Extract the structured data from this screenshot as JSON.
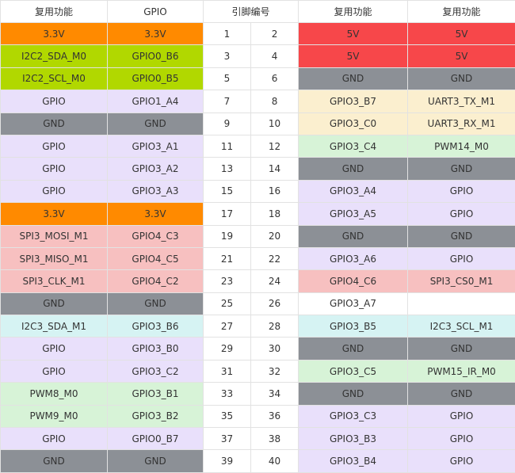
{
  "headers": {
    "left_func": "复用功能",
    "left_gpio": "GPIO",
    "pin_number": "引脚编号",
    "right_gpio_func": "复用功能",
    "right_func": "复用功能"
  },
  "colors": {
    "orange": "#ff8a00",
    "lime": "#b1d800",
    "lavender": "#e9e0fb",
    "gray": "#8c9096",
    "pink": "#f7c0c0",
    "cyan": "#d6f3f3",
    "green": "#d7f3d7",
    "red": "#f7474a",
    "cream": "#fbefcf",
    "white": "#ffffff"
  },
  "rows": [
    {
      "lf": "3.3V",
      "lg": "3.3V",
      "lc": "orange",
      "pl": "1",
      "pr": "2",
      "rg": "5V",
      "rf": "5V",
      "rc": "red"
    },
    {
      "lf": "I2C2_SDA_M0",
      "lg": "GPIO0_B6",
      "lc": "lime",
      "pl": "3",
      "pr": "4",
      "rg": "5V",
      "rf": "5V",
      "rc": "red"
    },
    {
      "lf": "I2C2_SCL_M0",
      "lg": "GPIO0_B5",
      "lc": "lime",
      "pl": "5",
      "pr": "6",
      "rg": "GND",
      "rf": "GND",
      "rc": "gray"
    },
    {
      "lf": "GPIO",
      "lg": "GPIO1_A4",
      "lc": "lav",
      "pl": "7",
      "pr": "8",
      "rg": "GPIO3_B7",
      "rf": "UART3_TX_M1",
      "rc": "cream"
    },
    {
      "lf": "GND",
      "lg": "GND",
      "lc": "gray",
      "pl": "9",
      "pr": "10",
      "rg": "GPIO3_C0",
      "rf": "UART3_RX_M1",
      "rc": "cream"
    },
    {
      "lf": "GPIO",
      "lg": "GPIO3_A1",
      "lc": "lav",
      "pl": "11",
      "pr": "12",
      "rg": "GPIO3_C4",
      "rf": "PWM14_M0",
      "rc": "green"
    },
    {
      "lf": "GPIO",
      "lg": "GPIO3_A2",
      "lc": "lav",
      "pl": "13",
      "pr": "14",
      "rg": "GND",
      "rf": "GND",
      "rc": "gray"
    },
    {
      "lf": "GPIO",
      "lg": "GPIO3_A3",
      "lc": "lav",
      "pl": "15",
      "pr": "16",
      "rg": "GPIO3_A4",
      "rf": "GPIO",
      "rc": "lav"
    },
    {
      "lf": "3.3V",
      "lg": "3.3V",
      "lc": "orange",
      "pl": "17",
      "pr": "18",
      "rg": "GPIO3_A5",
      "rf": "GPIO",
      "rc": "lav"
    },
    {
      "lf": "SPI3_MOSI_M1",
      "lg": "GPIO4_C3",
      "lc": "pink",
      "pl": "19",
      "pr": "20",
      "rg": "GND",
      "rf": "GND",
      "rc": "gray"
    },
    {
      "lf": "SPI3_MISO_M1",
      "lg": "GPIO4_C5",
      "lc": "pink",
      "pl": "21",
      "pr": "22",
      "rg": "GPIO3_A6",
      "rf": "GPIO",
      "rc": "lav"
    },
    {
      "lf": "SPI3_CLK_M1",
      "lg": "GPIO4_C2",
      "lc": "pink",
      "pl": "23",
      "pr": "24",
      "rg": "GPIO4_C6",
      "rf": "SPI3_CS0_M1",
      "rc": "pink"
    },
    {
      "lf": "GND",
      "lg": "GND",
      "lc": "gray",
      "pl": "25",
      "pr": "26",
      "rg": "GPIO3_A7",
      "rf": "",
      "rc": "white"
    },
    {
      "lf": "I2C3_SDA_M1",
      "lg": "GPIO3_B6",
      "lc": "cyan",
      "pl": "27",
      "pr": "28",
      "rg": "GPIO3_B5",
      "rf": "I2C3_SCL_M1",
      "rc": "cyan"
    },
    {
      "lf": "GPIO",
      "lg": "GPIO3_B0",
      "lc": "lav",
      "pl": "29",
      "pr": "30",
      "rg": "GND",
      "rf": "GND",
      "rc": "gray"
    },
    {
      "lf": "GPIO",
      "lg": "GPIO3_C2",
      "lc": "lav",
      "pl": "31",
      "pr": "32",
      "rg": "GPIO3_C5",
      "rf": "PWM15_IR_M0",
      "rc": "green"
    },
    {
      "lf": "PWM8_M0",
      "lg": "GPIO3_B1",
      "lc": "green",
      "pl": "33",
      "pr": "34",
      "rg": "GND",
      "rf": "GND",
      "rc": "gray"
    },
    {
      "lf": "PWM9_M0",
      "lg": "GPIO3_B2",
      "lc": "green",
      "pl": "35",
      "pr": "36",
      "rg": "GPIO3_C3",
      "rf": "GPIO",
      "rc": "lav"
    },
    {
      "lf": "GPIO",
      "lg": "GPIO0_B7",
      "lc": "lav",
      "pl": "37",
      "pr": "38",
      "rg": "GPIO3_B3",
      "rf": "GPIO",
      "rc": "lav"
    },
    {
      "lf": "GND",
      "lg": "GND",
      "lc": "gray",
      "pl": "39",
      "pr": "40",
      "rg": "GPIO3_B4",
      "rf": "GPIO",
      "rc": "lav"
    }
  ]
}
